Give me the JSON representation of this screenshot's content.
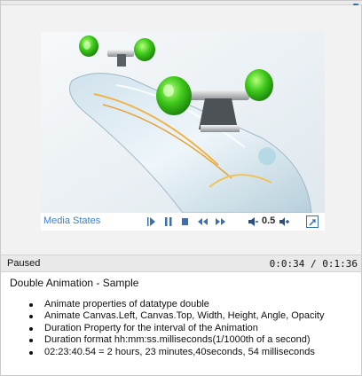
{
  "media": {
    "menu_label": "Media States",
    "volume": "0.5",
    "icons": {
      "play": "play-icon",
      "pause": "pause-icon",
      "stop": "stop-icon",
      "rewind": "rewind-icon",
      "fast_forward": "fast-forward-icon",
      "volume_down": "volume-down-icon",
      "volume_up": "volume-up-icon",
      "fullscreen": "fullscreen-icon"
    },
    "colors": {
      "accent": "#3a7fc7"
    }
  },
  "status": {
    "state": "Paused",
    "time": "0:0:34 / 0:1:36"
  },
  "description": {
    "title": "Double Animation - Sample",
    "bullets": [
      "Animate properties of datatype double",
      "Animate Canvas.Left, Canvas.Top, Width, Height, Angle, Opacity",
      "Duration Property for the interval of the Animation",
      "Duration format hh:mm:ss.milliseconds(1/1000th of a second)",
      "02:23:40.54 = 2 hours, 23 minutes,40seconds, 54 milliseconds"
    ]
  }
}
